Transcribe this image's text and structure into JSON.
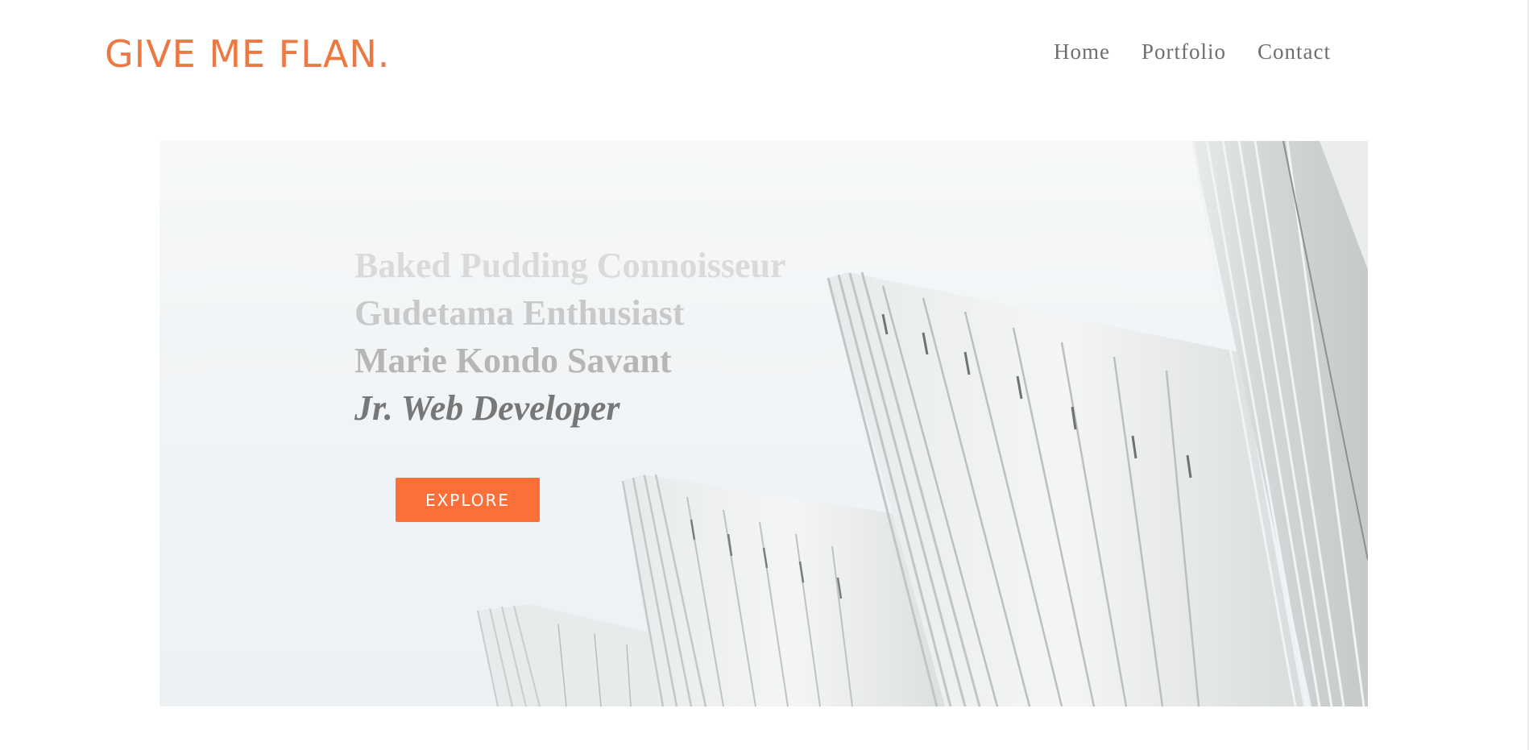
{
  "header": {
    "logo_text": "GIVE ME FLAN.",
    "nav": [
      {
        "label": "Home"
      },
      {
        "label": "Portfolio"
      },
      {
        "label": "Contact"
      }
    ]
  },
  "hero": {
    "taglines": [
      "Baked Pudding Connoisseur",
      "Gudetama Enthusiast",
      "Marie Kondo Savant",
      "Jr. Web Developer"
    ],
    "cta_label": "EXPLORE",
    "background_image": "white-architecture-fins-photo"
  },
  "colors": {
    "brand_orange": "#ec7844",
    "button_orange": "#fd6f38",
    "nav_text": "#6e6e6e",
    "tagline_active": "#777777"
  }
}
